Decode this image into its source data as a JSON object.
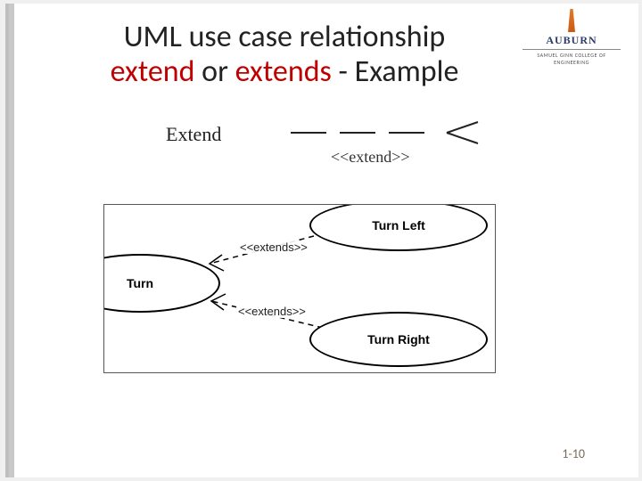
{
  "title": {
    "line1": "UML use case relationship",
    "extend_word": "extend",
    "or_word": " or ",
    "extends_word": "extends",
    "suffix": " - Example"
  },
  "logo": {
    "name": "AUBURN",
    "sub": "SAMUEL GINN COLLEGE OF ENGINEERING"
  },
  "notation": {
    "label": "Extend",
    "stereotype": "<<extend>>"
  },
  "diagram": {
    "usecases": {
      "turn": "Turn",
      "turn_left": "Turn Left",
      "turn_right": "Turn Right"
    },
    "rel1": "<<extends>>",
    "rel2": "<<extends>>"
  },
  "page_number": "1-10"
}
